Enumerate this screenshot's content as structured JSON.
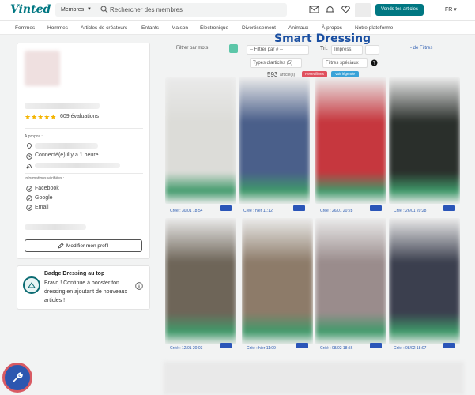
{
  "topbar": {
    "logo": "Vinted",
    "search_scope": "Membres",
    "search_placeholder": "Rechercher des membres",
    "sell_button": "Vends tes articles",
    "language": "FR"
  },
  "categories": [
    "Femmes",
    "Hommes",
    "Articles de créateurs",
    "Enfants",
    "Maison",
    "Électronique",
    "Divertissement",
    "Animaux",
    "À propos",
    "Notre plateforme"
  ],
  "profile": {
    "reviews_count": "609 évaluations",
    "stars": 5,
    "about_label": "À propos :",
    "last_seen": "Connecté(e) il y a 1 heure",
    "verified_label": "Informations vérifiées :",
    "verified": [
      "Facebook",
      "Google",
      "Email"
    ],
    "edit_button": "Modifier mon profil"
  },
  "badge_card": {
    "title": "Badge Dressing au top",
    "text": "Bravo ! Continue à booster ton dressing en ajoutant de nouveaux articles !"
  },
  "smart_dressing": {
    "title": "Smart Dressing",
    "filter_by_words": "Filtrer par mots",
    "filter_by_hash": "-- Filtrer par # --",
    "sort_label": "Tri:",
    "sort_value": "Impress.",
    "less_filters": "- de Filtres",
    "types": "Types d'articles (5)",
    "special_filters": "Filtres spéciaux",
    "count": "593",
    "count_unit": "article(s)",
    "reset_button": "Reset filtres",
    "legend_button": "Voir légende"
  },
  "items": [
    {
      "caption": "Créé : 30/01 18:54",
      "color": "#dcdcd8"
    },
    {
      "caption": "Créé : hier 11:12",
      "color": "#4a5f8a"
    },
    {
      "caption": "Créé : 26/01 20:28",
      "color": "#c6373e"
    },
    {
      "caption": "Créé : 26/01 20:28",
      "color": "#2a2f2b"
    },
    {
      "caption": "Créé : 12/01 20:03",
      "color": "#6e6558"
    },
    {
      "caption": "Créé : hier 11:09",
      "color": "#8d7b69"
    },
    {
      "caption": "Créé : 08/02 18:56",
      "color": "#9a8c8c"
    },
    {
      "caption": "Créé : 08/02 18:07",
      "color": "#3b3f4e"
    }
  ]
}
